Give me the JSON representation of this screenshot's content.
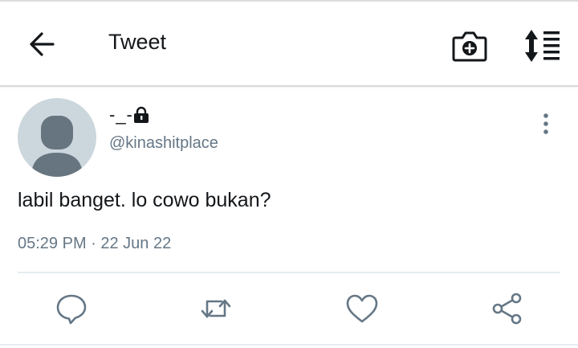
{
  "header": {
    "title": "Tweet",
    "icons": [
      "back-arrow-icon",
      "camera-icon",
      "sort-icon"
    ]
  },
  "tweet": {
    "display_name": "-_-",
    "handle": "@kinashitplace",
    "text": "labil banget. lo cowo bukan?",
    "timestamp": "05:29 PM · 22 Jun 22",
    "protected": true
  },
  "actions": [
    "reply-icon",
    "retweet-icon",
    "like-icon",
    "share-icon"
  ],
  "colors": {
    "text": "#14171a",
    "secondary_text": "#657786",
    "icon": "#657786",
    "avatar_bg": "#ccd6dd",
    "avatar_fg": "#66757f"
  }
}
